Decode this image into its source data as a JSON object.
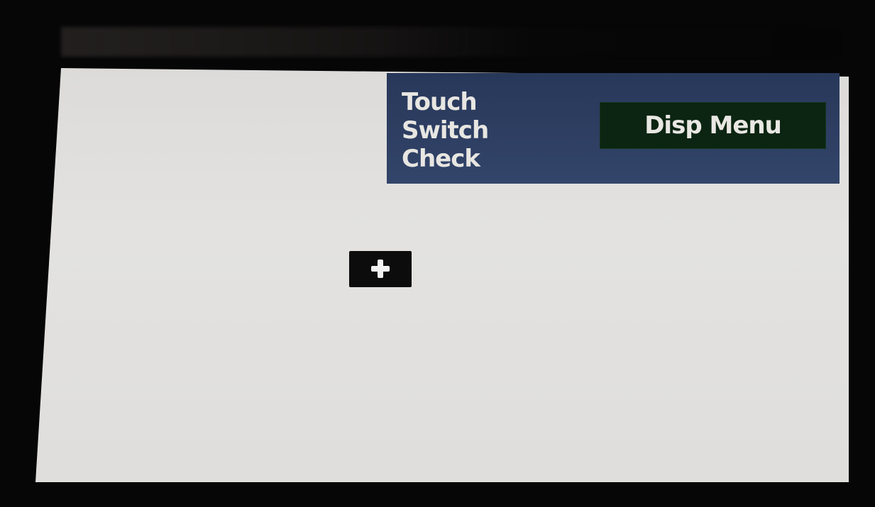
{
  "header": {
    "title_lines": [
      "Touch",
      "Switch",
      "Check"
    ]
  },
  "disp_menu_button": {
    "label": "Disp Menu"
  },
  "touch_target": {
    "icon": "plus-icon"
  },
  "colors": {
    "header_bg": "#2e3f63",
    "button_bg": "#0b2512",
    "screen_bg": "#e0dfdd",
    "target_bg": "#0c0c0c",
    "text": "#e8e6e2"
  }
}
